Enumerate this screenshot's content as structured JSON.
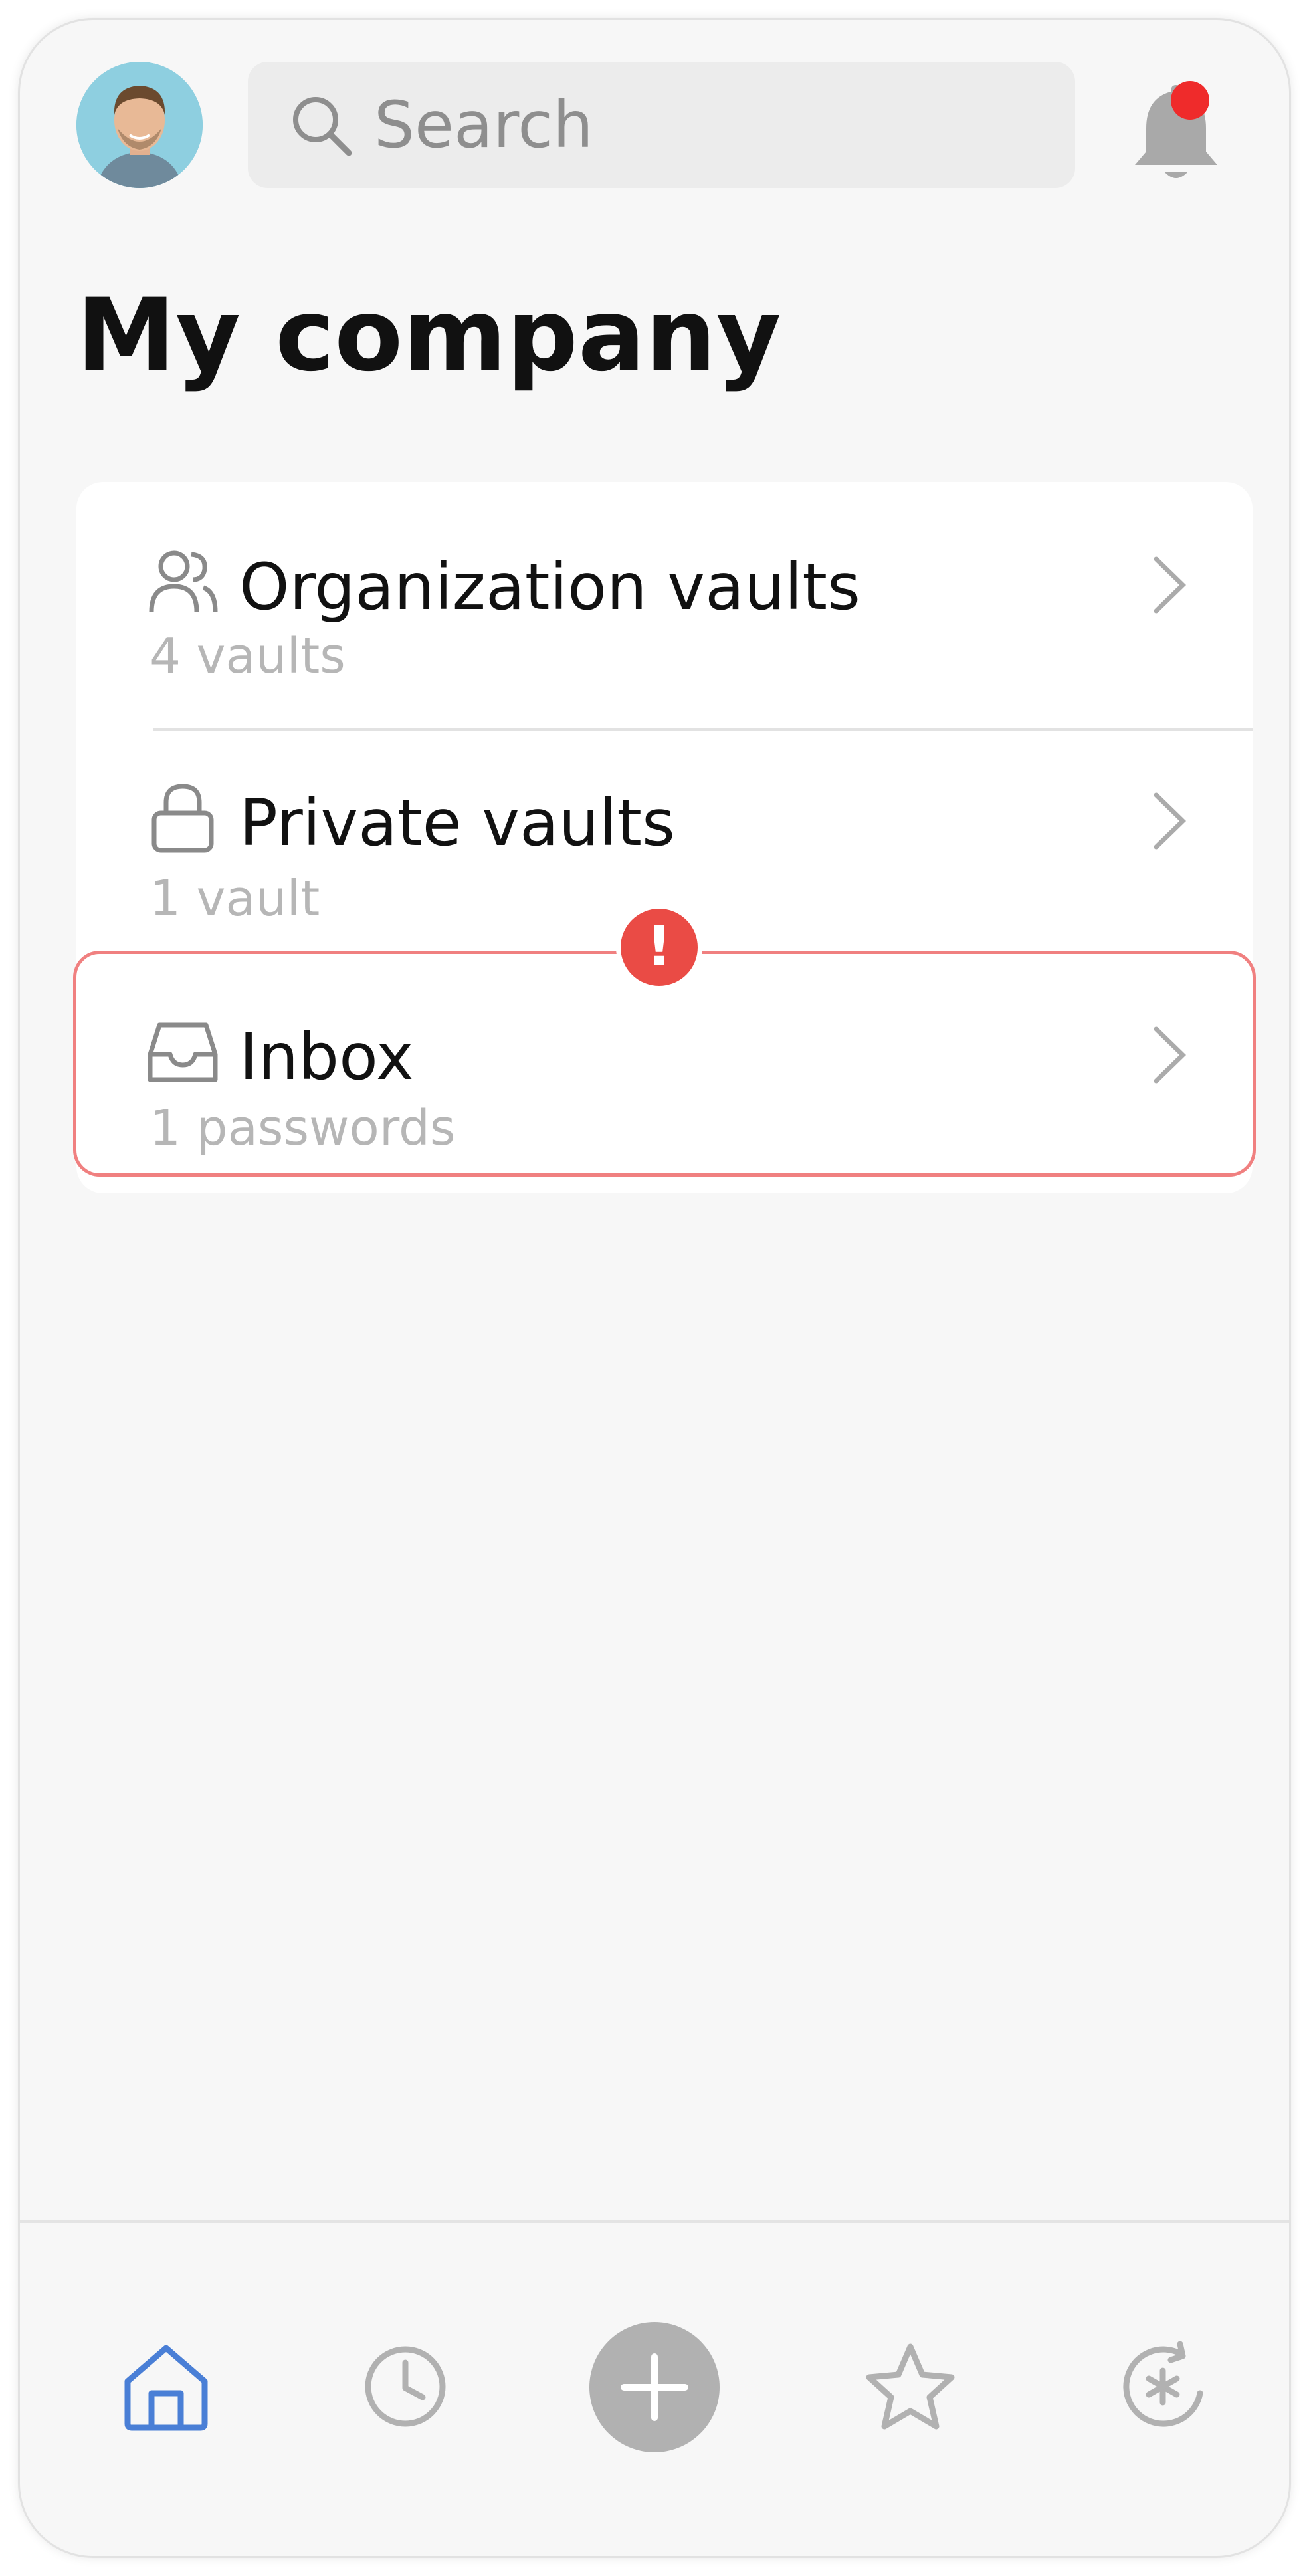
{
  "header": {
    "avatar_icon": "user-avatar",
    "search_placeholder": "Search",
    "search_icon": "search-icon",
    "notifications_icon": "bell-icon",
    "notification_dot_color": "#ef2b2b"
  },
  "page": {
    "title": "My company"
  },
  "vaults": [
    {
      "icon": "users-icon",
      "title": "Organization vaults",
      "subtitle": "4 vaults"
    },
    {
      "icon": "lock-icon",
      "title": "Private vaults",
      "subtitle": "1 vault"
    },
    {
      "icon": "inbox-icon",
      "title": "Inbox",
      "subtitle": "1 passwords",
      "alert": "!"
    }
  ],
  "colors": {
    "alert": "#ea4b45",
    "alert_border": "#f08080",
    "active_tab": "#4a7fd6",
    "inactive_tab": "#b1b1b1"
  },
  "tabbar": [
    {
      "icon": "home-icon",
      "active": true
    },
    {
      "icon": "clock-icon",
      "active": false
    },
    {
      "icon": "add-icon",
      "active": false
    },
    {
      "icon": "star-icon",
      "active": false
    },
    {
      "icon": "password-generator-icon",
      "active": false
    }
  ]
}
